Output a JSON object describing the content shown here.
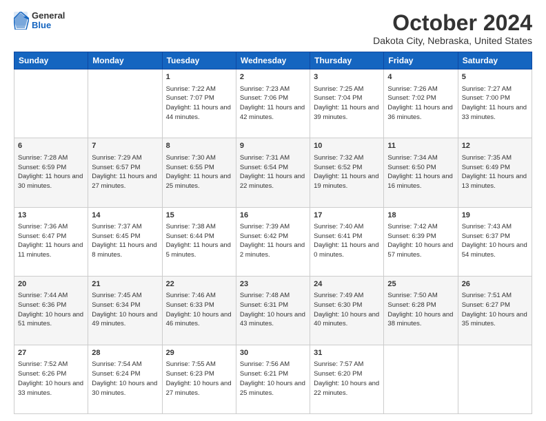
{
  "logo": {
    "general": "General",
    "blue": "Blue"
  },
  "title": "October 2024",
  "subtitle": "Dakota City, Nebraska, United States",
  "weekdays": [
    "Sunday",
    "Monday",
    "Tuesday",
    "Wednesday",
    "Thursday",
    "Friday",
    "Saturday"
  ],
  "weeks": [
    [
      {
        "day": "",
        "info": ""
      },
      {
        "day": "",
        "info": ""
      },
      {
        "day": "1",
        "info": "Sunrise: 7:22 AM\nSunset: 7:07 PM\nDaylight: 11 hours and 44 minutes."
      },
      {
        "day": "2",
        "info": "Sunrise: 7:23 AM\nSunset: 7:06 PM\nDaylight: 11 hours and 42 minutes."
      },
      {
        "day": "3",
        "info": "Sunrise: 7:25 AM\nSunset: 7:04 PM\nDaylight: 11 hours and 39 minutes."
      },
      {
        "day": "4",
        "info": "Sunrise: 7:26 AM\nSunset: 7:02 PM\nDaylight: 11 hours and 36 minutes."
      },
      {
        "day": "5",
        "info": "Sunrise: 7:27 AM\nSunset: 7:00 PM\nDaylight: 11 hours and 33 minutes."
      }
    ],
    [
      {
        "day": "6",
        "info": "Sunrise: 7:28 AM\nSunset: 6:59 PM\nDaylight: 11 hours and 30 minutes."
      },
      {
        "day": "7",
        "info": "Sunrise: 7:29 AM\nSunset: 6:57 PM\nDaylight: 11 hours and 27 minutes."
      },
      {
        "day": "8",
        "info": "Sunrise: 7:30 AM\nSunset: 6:55 PM\nDaylight: 11 hours and 25 minutes."
      },
      {
        "day": "9",
        "info": "Sunrise: 7:31 AM\nSunset: 6:54 PM\nDaylight: 11 hours and 22 minutes."
      },
      {
        "day": "10",
        "info": "Sunrise: 7:32 AM\nSunset: 6:52 PM\nDaylight: 11 hours and 19 minutes."
      },
      {
        "day": "11",
        "info": "Sunrise: 7:34 AM\nSunset: 6:50 PM\nDaylight: 11 hours and 16 minutes."
      },
      {
        "day": "12",
        "info": "Sunrise: 7:35 AM\nSunset: 6:49 PM\nDaylight: 11 hours and 13 minutes."
      }
    ],
    [
      {
        "day": "13",
        "info": "Sunrise: 7:36 AM\nSunset: 6:47 PM\nDaylight: 11 hours and 11 minutes."
      },
      {
        "day": "14",
        "info": "Sunrise: 7:37 AM\nSunset: 6:45 PM\nDaylight: 11 hours and 8 minutes."
      },
      {
        "day": "15",
        "info": "Sunrise: 7:38 AM\nSunset: 6:44 PM\nDaylight: 11 hours and 5 minutes."
      },
      {
        "day": "16",
        "info": "Sunrise: 7:39 AM\nSunset: 6:42 PM\nDaylight: 11 hours and 2 minutes."
      },
      {
        "day": "17",
        "info": "Sunrise: 7:40 AM\nSunset: 6:41 PM\nDaylight: 11 hours and 0 minutes."
      },
      {
        "day": "18",
        "info": "Sunrise: 7:42 AM\nSunset: 6:39 PM\nDaylight: 10 hours and 57 minutes."
      },
      {
        "day": "19",
        "info": "Sunrise: 7:43 AM\nSunset: 6:37 PM\nDaylight: 10 hours and 54 minutes."
      }
    ],
    [
      {
        "day": "20",
        "info": "Sunrise: 7:44 AM\nSunset: 6:36 PM\nDaylight: 10 hours and 51 minutes."
      },
      {
        "day": "21",
        "info": "Sunrise: 7:45 AM\nSunset: 6:34 PM\nDaylight: 10 hours and 49 minutes."
      },
      {
        "day": "22",
        "info": "Sunrise: 7:46 AM\nSunset: 6:33 PM\nDaylight: 10 hours and 46 minutes."
      },
      {
        "day": "23",
        "info": "Sunrise: 7:48 AM\nSunset: 6:31 PM\nDaylight: 10 hours and 43 minutes."
      },
      {
        "day": "24",
        "info": "Sunrise: 7:49 AM\nSunset: 6:30 PM\nDaylight: 10 hours and 40 minutes."
      },
      {
        "day": "25",
        "info": "Sunrise: 7:50 AM\nSunset: 6:28 PM\nDaylight: 10 hours and 38 minutes."
      },
      {
        "day": "26",
        "info": "Sunrise: 7:51 AM\nSunset: 6:27 PM\nDaylight: 10 hours and 35 minutes."
      }
    ],
    [
      {
        "day": "27",
        "info": "Sunrise: 7:52 AM\nSunset: 6:26 PM\nDaylight: 10 hours and 33 minutes."
      },
      {
        "day": "28",
        "info": "Sunrise: 7:54 AM\nSunset: 6:24 PM\nDaylight: 10 hours and 30 minutes."
      },
      {
        "day": "29",
        "info": "Sunrise: 7:55 AM\nSunset: 6:23 PM\nDaylight: 10 hours and 27 minutes."
      },
      {
        "day": "30",
        "info": "Sunrise: 7:56 AM\nSunset: 6:21 PM\nDaylight: 10 hours and 25 minutes."
      },
      {
        "day": "31",
        "info": "Sunrise: 7:57 AM\nSunset: 6:20 PM\nDaylight: 10 hours and 22 minutes."
      },
      {
        "day": "",
        "info": ""
      },
      {
        "day": "",
        "info": ""
      }
    ]
  ]
}
